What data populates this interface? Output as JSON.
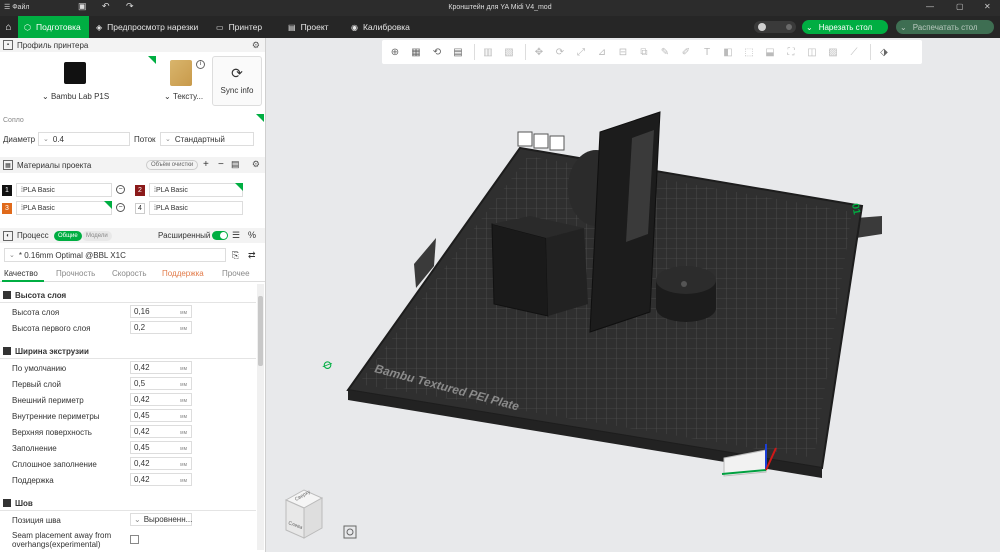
{
  "titlebar": {
    "menu": "Файл",
    "title": "Кронштейн для YA Midi V4_mod"
  },
  "nav": {
    "tabs": [
      {
        "label": "Подготовка",
        "icon": "cube-icon",
        "active": true
      },
      {
        "label": "Предпросмотр нарезки",
        "icon": "layers-icon",
        "active": false
      },
      {
        "label": "Принтер",
        "icon": "monitor-icon",
        "active": false
      },
      {
        "label": "Проект",
        "icon": "project-icon",
        "active": false
      },
      {
        "label": "Калибровка",
        "icon": "calibration-icon",
        "active": false
      }
    ],
    "slice_button": "Нарезать стол",
    "print_button": "Распечатать стол"
  },
  "printer": {
    "section_title": "Профиль принтера",
    "printer_name": "Bambu Lab P1S",
    "plate_name": "Тексту...",
    "sync_label": "Sync info"
  },
  "nozzle": {
    "section_title": "Сопло",
    "diameter_label": "Диаметр",
    "diameter_value": "0.4",
    "flow_label": "Поток",
    "flow_value": "Стандартный"
  },
  "materials": {
    "section_title": "Материалы проекта",
    "volume_button": "Объём очистки",
    "items": [
      {
        "num": "1",
        "color": "#111111",
        "name": "PLA Basic"
      },
      {
        "num": "2",
        "color": "#8b1a1a",
        "name": "PLA Basic"
      },
      {
        "num": "3",
        "color": "#e06a1b",
        "name": "PLA Basic"
      },
      {
        "num": "4",
        "color": "#ffffff",
        "name": "PLA Basic"
      }
    ]
  },
  "process": {
    "section_title": "Процесс",
    "pill_general": "Общие",
    "pill_models": "Модели",
    "advanced_label": "Расширенный",
    "preset": "* 0.16mm Optimal @BBL X1C",
    "tabs": [
      "Качество",
      "Прочность",
      "Скорость",
      "Поддержка",
      "Прочее"
    ]
  },
  "quality": {
    "layer_height_group": "Высота слоя",
    "layer_height_label": "Высота слоя",
    "layer_height_value": "0,16",
    "first_layer_height_label": "Высота первого слоя",
    "first_layer_height_value": "0,2",
    "unit": "мм",
    "extrusion_group": "Ширина экструзии",
    "extrusion": [
      {
        "label": "По умолчанию",
        "value": "0,42"
      },
      {
        "label": "Первый слой",
        "value": "0,5"
      },
      {
        "label": "Внешний периметр",
        "value": "0,42"
      },
      {
        "label": "Внутренние периметры",
        "value": "0,45"
      },
      {
        "label": "Верхняя поверхность",
        "value": "0,42"
      },
      {
        "label": "Заполнение",
        "value": "0,45"
      },
      {
        "label": "Сплошное заполнение",
        "value": "0,42"
      },
      {
        "label": "Поддержка",
        "value": "0,42"
      }
    ],
    "seam_group": "Шов",
    "seam_position_label": "Позиция шва",
    "seam_position_value": "Выровненн...",
    "seam_away_label_1": "Seam placement away from",
    "seam_away_label_2": "overhangs(experimental)"
  },
  "viewport": {
    "plate_text": "Bambu Textured PEI Plate",
    "plate_number": "01",
    "cube_front": "Слева",
    "cube_top": "Сверху"
  }
}
